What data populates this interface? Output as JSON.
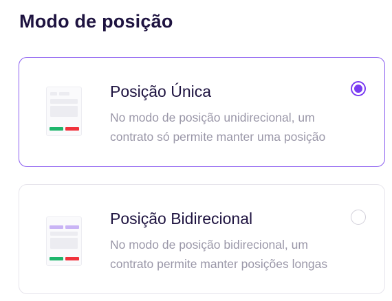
{
  "header": {
    "title": "Modo de posição"
  },
  "options": [
    {
      "title": "Posição Única",
      "description_line1": "No modo de posição unidirecional, um",
      "description_line2": "contrato só permite manter uma posição",
      "selected": true
    },
    {
      "title": "Posição Bidirecional",
      "description_line1": "No modo de posição bidirecional, um",
      "description_line2": "contrato permite manter posições longas",
      "selected": false
    }
  ],
  "colors": {
    "accent": "#7a3cf2",
    "selected_border": "#8a5cf0",
    "title_text": "#1e1340",
    "description_text": "#9a97a8",
    "buy_green": "#1db56b",
    "sell_red": "#f0323c",
    "bidirectional_bar": "#c9b4f5"
  },
  "icons": {
    "option1_thumbnail": "single-position-preview-icon",
    "option2_thumbnail": "bidirectional-position-preview-icon"
  }
}
